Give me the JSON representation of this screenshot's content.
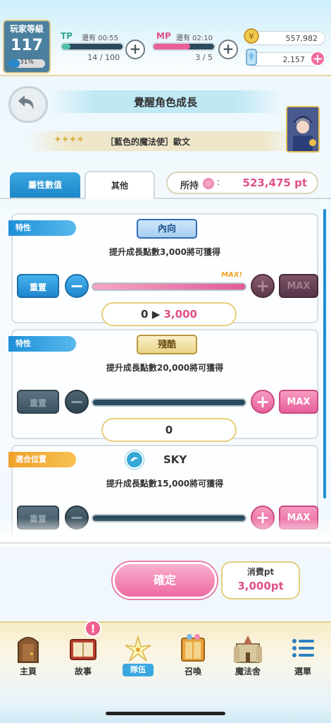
{
  "player": {
    "level_label": "玩家等級",
    "level": "117",
    "exp_percent": "31%",
    "exp_fraction": 0.31
  },
  "tp": {
    "label": "TP",
    "remaining": "還有 00:55",
    "value": "14 / 100",
    "fraction": 0.14
  },
  "mp": {
    "label": "MP",
    "remaining": "還有 02:10",
    "value": "3 / 5",
    "fraction": 0.6
  },
  "currency": {
    "coins": "557,982",
    "gems": "2,157"
  },
  "page": {
    "title": "覺醒角色成長",
    "stars": "✦✦✦✦",
    "character": "［藍色的魔法使］歐文"
  },
  "tabs": {
    "stats": "屬性數值",
    "other": "其他"
  },
  "points": {
    "label": "所持",
    "colon": ":",
    "value": "523,475 pt"
  },
  "cards": [
    {
      "tag": "特性",
      "badge": "內向",
      "desc": "提升成長點數3,000將可獲得",
      "reset": "重置",
      "minus": "−",
      "plus": "+",
      "max": "MAX",
      "max_marker": "MAX!",
      "value_old": "0",
      "arrow": "▶",
      "value_new": "3,000",
      "fill_fraction": 1.0
    },
    {
      "tag": "特性",
      "badge": "殘酷",
      "desc": "提升成長點數20,000將可獲得",
      "reset": "重置",
      "minus": "−",
      "plus": "+",
      "max": "MAX",
      "value": "0",
      "fill_fraction": 0
    },
    {
      "tag": "適合位置",
      "badge": "SKY",
      "desc": "提升成長點數15,000將可獲得",
      "reset": "重置",
      "minus": "−",
      "plus": "+",
      "max": "MAX",
      "fill_fraction": 0
    }
  ],
  "confirm": {
    "label": "確定",
    "cost_label": "消費pt",
    "cost_value": "3,000pt"
  },
  "nav": [
    {
      "label": "主頁",
      "icon": "door-icon"
    },
    {
      "label": "故事",
      "icon": "book-icon",
      "badge": "!"
    },
    {
      "label": "隊伍",
      "icon": "lily-icon",
      "active": true
    },
    {
      "label": "召喚",
      "icon": "summon-icon"
    },
    {
      "label": "魔法舍",
      "icon": "castle-icon"
    },
    {
      "label": "選單",
      "icon": "menu-list-icon"
    }
  ],
  "colors": {
    "accent_pink": "#e0508a",
    "accent_blue": "#1f87c8",
    "gold": "#d9b44a"
  }
}
